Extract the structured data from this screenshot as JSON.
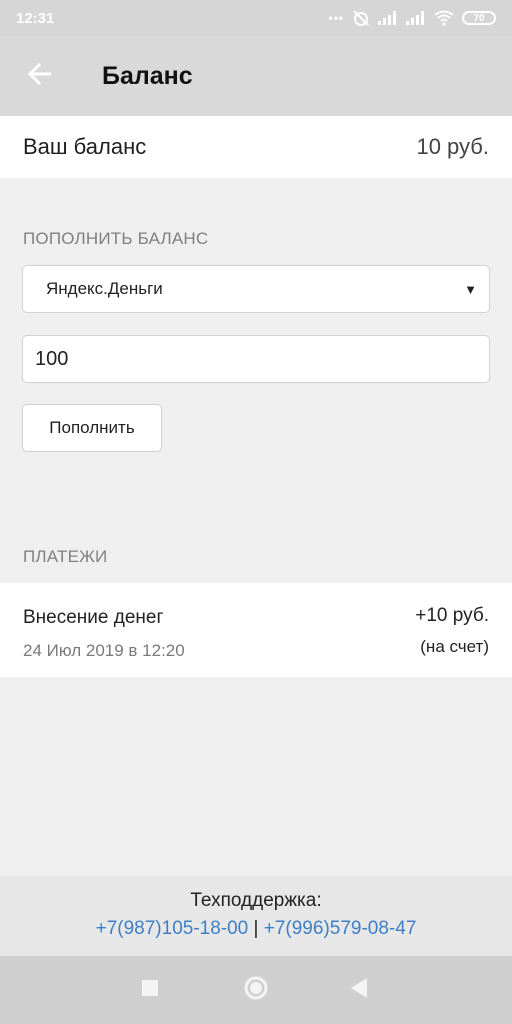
{
  "status_bar": {
    "time": "12:31",
    "dots": "•••",
    "battery": "70",
    "icons": [
      "alarm-off-icon",
      "signal-icon",
      "signal-icon",
      "wifi-icon",
      "battery-icon"
    ]
  },
  "app_bar": {
    "back_icon": "arrow-left-icon",
    "title": "Баланс"
  },
  "balance": {
    "label": "Ваш баланс",
    "value": "10 руб."
  },
  "topup": {
    "section_label": "ПОПОЛНИТЬ БАЛАНС",
    "method_selected": "Яндекс.Деньги",
    "amount_value": "100",
    "button_label": "Пополнить"
  },
  "payments": {
    "section_label": "ПЛАТЕЖИ",
    "items": [
      {
        "title": "Внесение денег",
        "date": "24 Июл 2019 в 12:20",
        "amount": "+10 руб.",
        "note": "(на счет)"
      }
    ]
  },
  "support": {
    "label": "Техподдержка:",
    "phone_1": "+7(987)105-18-00",
    "separator": "|",
    "phone_2": "+7(996)579-08-47",
    "link_color": "#3d7fc6"
  },
  "nav_bar": {
    "icons": [
      "square-recents-icon",
      "circle-home-icon",
      "triangle-back-icon"
    ]
  }
}
